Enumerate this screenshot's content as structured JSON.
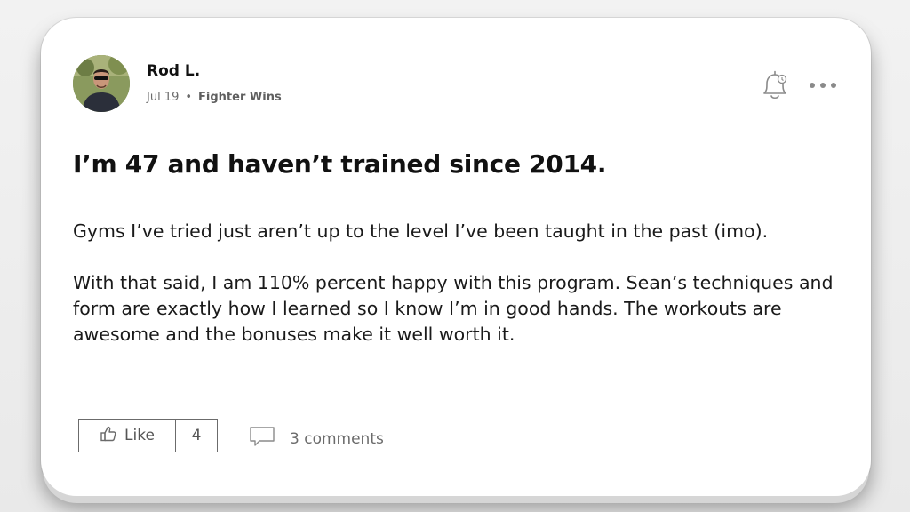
{
  "post": {
    "author": "Rod L.",
    "date": "Jul 19",
    "separator": "•",
    "group": "Fighter Wins",
    "title": "I’m 47 and haven’t trained since 2014.",
    "paragraphs": [
      "Gyms I’ve tried just aren’t up to the level I’ve been taught in the past (imo).",
      "With that said, I am 110% percent happy with this program. Sean’s techniques and form are exactly how I learned so I know I’m in good hands. The workouts are awesome and the bonuses make it well worth it."
    ]
  },
  "actions": {
    "like_label": "Like",
    "like_count": "4",
    "comments_label": "3 comments"
  },
  "icons": {
    "avatar": "user-avatar-photo",
    "bell": "notification-bell-icon",
    "more": "more-options-icon",
    "like": "thumbs-up-icon",
    "comment": "comment-bubble-icon"
  },
  "colors": {
    "card_bg": "#ffffff",
    "text_primary": "#111111",
    "text_muted": "#6b6b6b",
    "page_bg": "#efefef"
  }
}
